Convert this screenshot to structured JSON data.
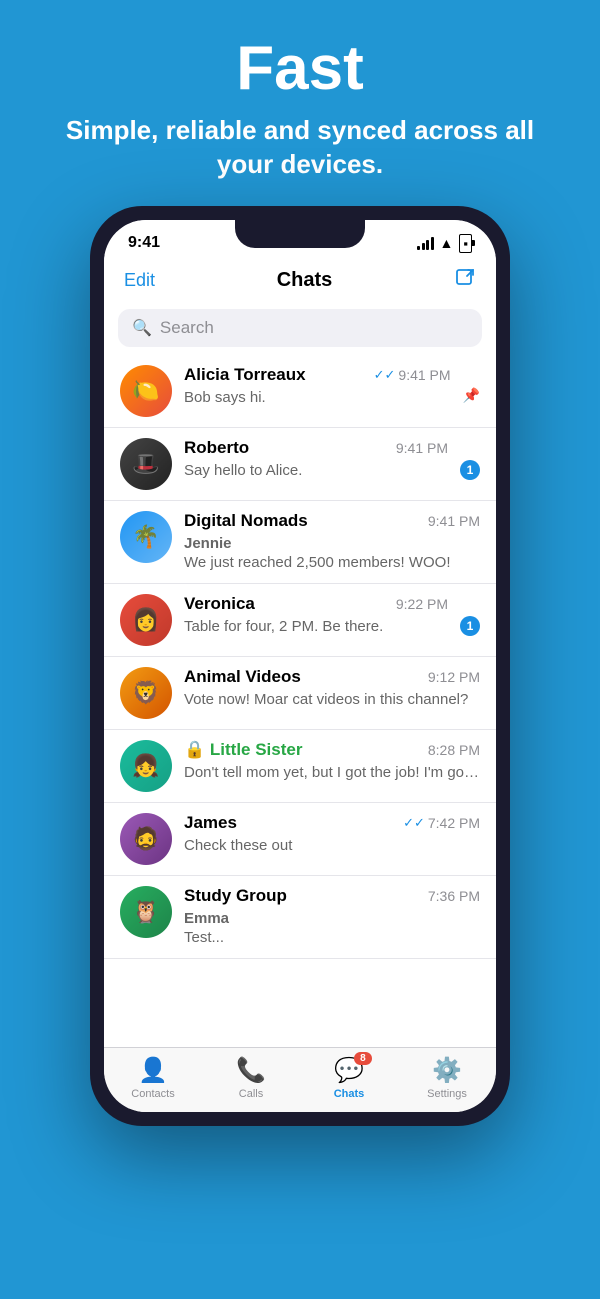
{
  "hero": {
    "title": "Fast",
    "subtitle": "Simple, reliable and synced across all your devices."
  },
  "phone": {
    "status": {
      "time": "9:41"
    },
    "navbar": {
      "edit": "Edit",
      "title": "Chats",
      "compose_icon": "✏"
    },
    "search": {
      "placeholder": "Search"
    },
    "chats": [
      {
        "id": "alicia",
        "name": "Alicia Torreaux",
        "preview": "Bob says hi.",
        "time": "9:41 PM",
        "avatar_emoji": "🍋",
        "avatar_class": "av-orange",
        "badge": null,
        "pinned": true,
        "double_check": true,
        "is_group": false,
        "is_locked": false
      },
      {
        "id": "roberto",
        "name": "Roberto",
        "preview": "Say hello to Alice.",
        "time": "9:41 PM",
        "avatar_emoji": "🎩",
        "avatar_class": "av-dark",
        "badge": "1",
        "pinned": false,
        "double_check": false,
        "is_group": false,
        "is_locked": false
      },
      {
        "id": "digital-nomads",
        "name": "Digital Nomads",
        "preview": "Jennie\nWe just reached 2,500 members! WOO!",
        "time": "9:41 PM",
        "avatar_emoji": "🌴",
        "avatar_class": "av-blue",
        "badge": null,
        "pinned": false,
        "double_check": false,
        "is_group": true,
        "is_locked": false
      },
      {
        "id": "veronica",
        "name": "Veronica",
        "preview": "Table for four, 2 PM. Be there.",
        "time": "9:22 PM",
        "avatar_emoji": "👩",
        "avatar_class": "av-red",
        "badge": "1",
        "pinned": false,
        "double_check": false,
        "is_group": false,
        "is_locked": false
      },
      {
        "id": "animal-videos",
        "name": "Animal Videos",
        "preview": "Vote now! Moar cat videos in this channel?",
        "time": "9:12 PM",
        "avatar_emoji": "🦁",
        "avatar_class": "av-gold",
        "badge": null,
        "pinned": false,
        "double_check": false,
        "is_group": true,
        "is_locked": false
      },
      {
        "id": "little-sister",
        "name": "Little Sister",
        "preview": "Don't tell mom yet, but I got the job! I'm going to ROME!",
        "time": "8:28 PM",
        "avatar_emoji": "👧",
        "avatar_class": "av-teal",
        "badge": null,
        "pinned": false,
        "double_check": false,
        "is_group": false,
        "is_locked": true
      },
      {
        "id": "james",
        "name": "James",
        "preview": "Check these out",
        "time": "7:42 PM",
        "avatar_emoji": "🧔",
        "avatar_class": "av-purple",
        "badge": null,
        "pinned": false,
        "double_check": true,
        "is_group": false,
        "is_locked": false
      },
      {
        "id": "study-group",
        "name": "Study Group",
        "preview": "Emma\nTest...",
        "time": "7:36 PM",
        "avatar_emoji": "🦉",
        "avatar_class": "av-green",
        "badge": null,
        "pinned": false,
        "double_check": false,
        "is_group": true,
        "is_locked": false
      }
    ],
    "tabs": [
      {
        "id": "contacts",
        "label": "Contacts",
        "icon": "👤",
        "active": false
      },
      {
        "id": "calls",
        "label": "Calls",
        "icon": "📞",
        "active": false
      },
      {
        "id": "chats",
        "label": "Chats",
        "icon": "💬",
        "active": true,
        "badge": "8"
      },
      {
        "id": "settings",
        "label": "Settings",
        "icon": "⚙️",
        "active": false
      }
    ]
  }
}
